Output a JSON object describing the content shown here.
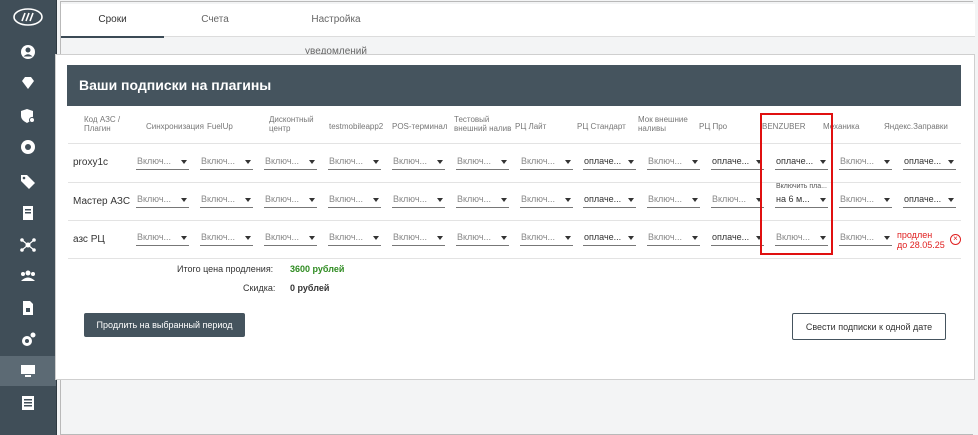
{
  "tabs": [
    "Сроки",
    "Счета",
    "Настройка уведомлений"
  ],
  "card_title": "Ваши подписки на плагины",
  "columns": [
    "Код АЗС / Плагин",
    "Синхронизация",
    "FuelUp",
    "Дисконтный центр",
    "testmobileapp2",
    "POS-терминал",
    "Тестовый внешний налив",
    "РЦ Лайт",
    "РЦ Стандарт",
    "Мок внешние наливы",
    "РЦ Про",
    "BENZUBER",
    "Механика",
    "Яндекс.Заправки"
  ],
  "rows": [
    {
      "label": "proxy1c",
      "values": [
        "Включ...",
        "Включ...",
        "Включ...",
        "Включ...",
        "Включ...",
        "Включ...",
        "Включ...",
        "оплаче...",
        "Включ...",
        "оплаче...",
        "оплаче...",
        "Включ...",
        "оплаче..."
      ]
    },
    {
      "label": "Мастер АЗС",
      "values": [
        "Включ...",
        "Включ...",
        "Включ...",
        "Включ...",
        "Включ...",
        "Включ...",
        "Включ...",
        "оплаче...",
        "Включ...",
        "Включ...",
        "на 6 м...",
        "Включ...",
        "оплаче..."
      ]
    },
    {
      "label": "азс РЦ",
      "values": [
        "Включ...",
        "Включ...",
        "Включ...",
        "Включ...",
        "Включ...",
        "Включ...",
        "Включ...",
        "оплаче...",
        "Включ...",
        "оплаче...",
        "Включ...",
        "Включ...",
        ""
      ]
    }
  ],
  "benzuber_hint": "Включить пла...",
  "renew_note_line1": "продлен",
  "renew_note_line2": "до 28.05.25",
  "total_label": "Итого цена продления:",
  "total_value": "3600 рублей",
  "discount_label": "Скидка:",
  "discount_value": "0 рублей",
  "btn_extend": "Продлить на выбранный период",
  "btn_align": "Свести подписки к одной дате",
  "colors": {
    "accent": "#45545e",
    "total_green": "#2e8b20",
    "alert_red": "#e02020"
  },
  "sidebar_icons": [
    "user-icon",
    "diamond-icon",
    "shield-settings-icon",
    "lifebuoy-icon",
    "tag-icon",
    "receipt-icon",
    "network-icon",
    "team-icon",
    "document-icon",
    "gear-icon",
    "monitor-icon",
    "list-icon"
  ]
}
